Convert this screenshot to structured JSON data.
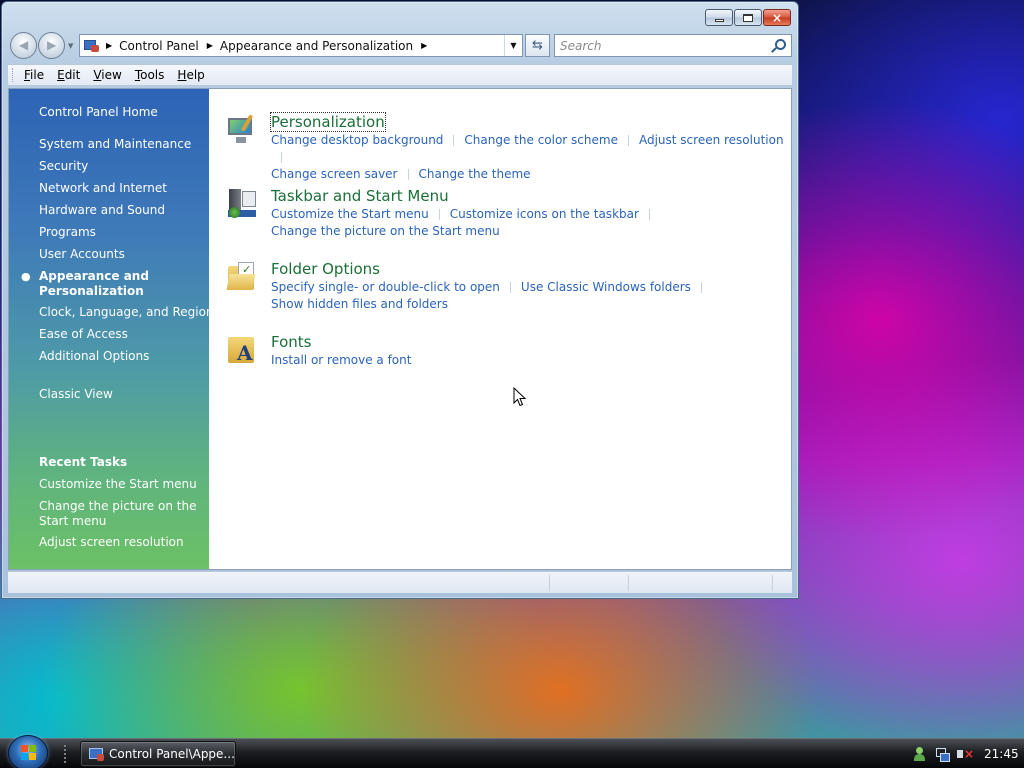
{
  "window": {
    "caption_buttons": {
      "minimize": "minimize-icon",
      "maximize": "maximize-icon",
      "close": "×"
    }
  },
  "address_bar": {
    "breadcrumbs": [
      "Control Panel",
      "Appearance and Personalization"
    ],
    "search_placeholder": "Search"
  },
  "menu": [
    {
      "label": "File",
      "accel": "F",
      "rest": "ile"
    },
    {
      "label": "Edit",
      "accel": "E",
      "rest": "dit"
    },
    {
      "label": "View",
      "accel": "V",
      "rest": "iew"
    },
    {
      "label": "Tools",
      "accel": "T",
      "rest": "ools"
    },
    {
      "label": "Help",
      "accel": "H",
      "rest": "elp"
    }
  ],
  "sidebar": {
    "home": "Control Panel Home",
    "items": [
      "System and Maintenance",
      "Security",
      "Network and Internet",
      "Hardware and Sound",
      "Programs",
      "User Accounts"
    ],
    "current_line1": "Appearance and",
    "current_line2": "Personalization",
    "items_after": [
      "Clock, Language, and Region",
      "Ease of Access",
      "Additional Options"
    ],
    "classic_view": "Classic View",
    "recent_tasks_title": "Recent Tasks",
    "recent_tasks": {
      "t1": "Customize the Start menu",
      "t2_line1": "Change the picture on the",
      "t2_line2": "Start menu",
      "t3": "Adjust screen resolution"
    }
  },
  "categories": [
    {
      "title": "Personalization",
      "icon": "personalization-icon",
      "row1": [
        "Change desktop background",
        "Change the color scheme",
        "Adjust screen resolution"
      ],
      "row2": [
        "Change screen saver",
        "Change the theme"
      ]
    },
    {
      "title": "Taskbar and Start Menu",
      "icon": "taskbar-start-menu-icon",
      "row1": [
        "Customize the Start menu",
        "Customize icons on the taskbar"
      ],
      "row2": [
        "Change the picture on the Start menu"
      ]
    },
    {
      "title": "Folder Options",
      "icon": "folder-options-icon",
      "row1": [
        "Specify single- or double-click to open",
        "Use Classic Windows folders"
      ],
      "row2": [
        "Show hidden files and folders"
      ]
    },
    {
      "title": "Fonts",
      "icon": "fonts-icon",
      "row1": [
        "Install or remove a font"
      ],
      "row2": []
    }
  ],
  "taskbar": {
    "task_label": "Control Panel\\Appe...",
    "clock": "21:45"
  }
}
